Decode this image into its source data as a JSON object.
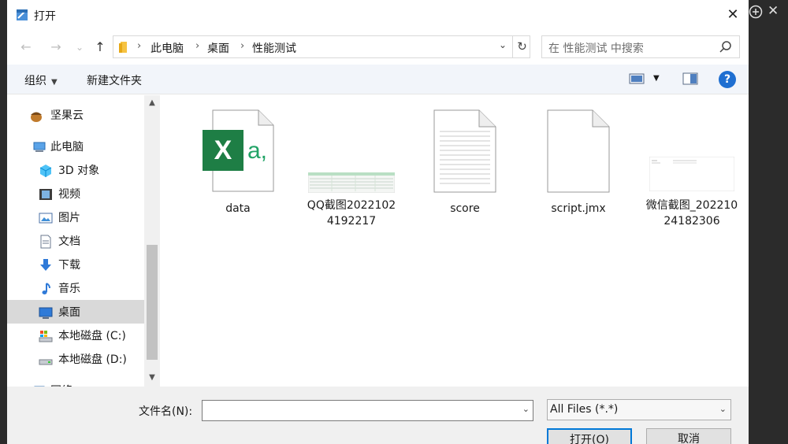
{
  "window": {
    "title": "打开",
    "close": "✕"
  },
  "nav": {
    "back": "←",
    "forward": "→",
    "recent": "⌄",
    "up": "↑"
  },
  "address": {
    "crumbs": [
      "此电脑",
      "桌面",
      "性能测试"
    ],
    "sep": "›",
    "dropdown": "⌄",
    "refresh": "↻"
  },
  "search": {
    "placeholder": "在 性能测试 中搜索"
  },
  "toolbar": {
    "organize": "组织",
    "caret": "▼",
    "new_folder": "新建文件夹",
    "view_caret": "▼",
    "help": "?"
  },
  "sidebar": {
    "items": [
      {
        "label": "坚果云",
        "icon": "nut-icon"
      },
      {
        "label": "此电脑",
        "icon": "computer-icon"
      },
      {
        "label": "3D 对象",
        "icon": "3d-objects-icon"
      },
      {
        "label": "视频",
        "icon": "video-icon"
      },
      {
        "label": "图片",
        "icon": "pictures-icon"
      },
      {
        "label": "文档",
        "icon": "documents-icon"
      },
      {
        "label": "下载",
        "icon": "download-icon"
      },
      {
        "label": "音乐",
        "icon": "music-icon"
      },
      {
        "label": "桌面",
        "icon": "desktop-icon",
        "selected": true
      },
      {
        "label": "本地磁盘 (C:)",
        "icon": "drive-c-icon"
      },
      {
        "label": "本地磁盘 (D:)",
        "icon": "drive-d-icon"
      },
      {
        "label": "网络",
        "icon": "network-icon"
      }
    ],
    "scroll_up": "▲",
    "scroll_down": "▼"
  },
  "files": [
    {
      "name": "data",
      "type": "excel"
    },
    {
      "name": "QQ截图20221024192217",
      "type": "image-table"
    },
    {
      "name": "score",
      "type": "text"
    },
    {
      "name": "script.jmx",
      "type": "blank"
    },
    {
      "name": "微信截图_20221024182306",
      "type": "image-blank"
    }
  ],
  "excel_icon": {
    "letter": "X",
    "badge": "a,"
  },
  "bottom": {
    "filename_label": "文件名(N):",
    "filename_value": "",
    "filename_dropdown": "⌄",
    "filter_value": "All Files (*.*)",
    "filter_dropdown": "⌄",
    "open_button": "打开(O)",
    "cancel_button": "取消"
  },
  "colors": {
    "accent": "#0078d7",
    "excel_green": "#1e7e45",
    "selected_bg": "#d9d9d9",
    "help_blue": "#1f6fd1"
  }
}
